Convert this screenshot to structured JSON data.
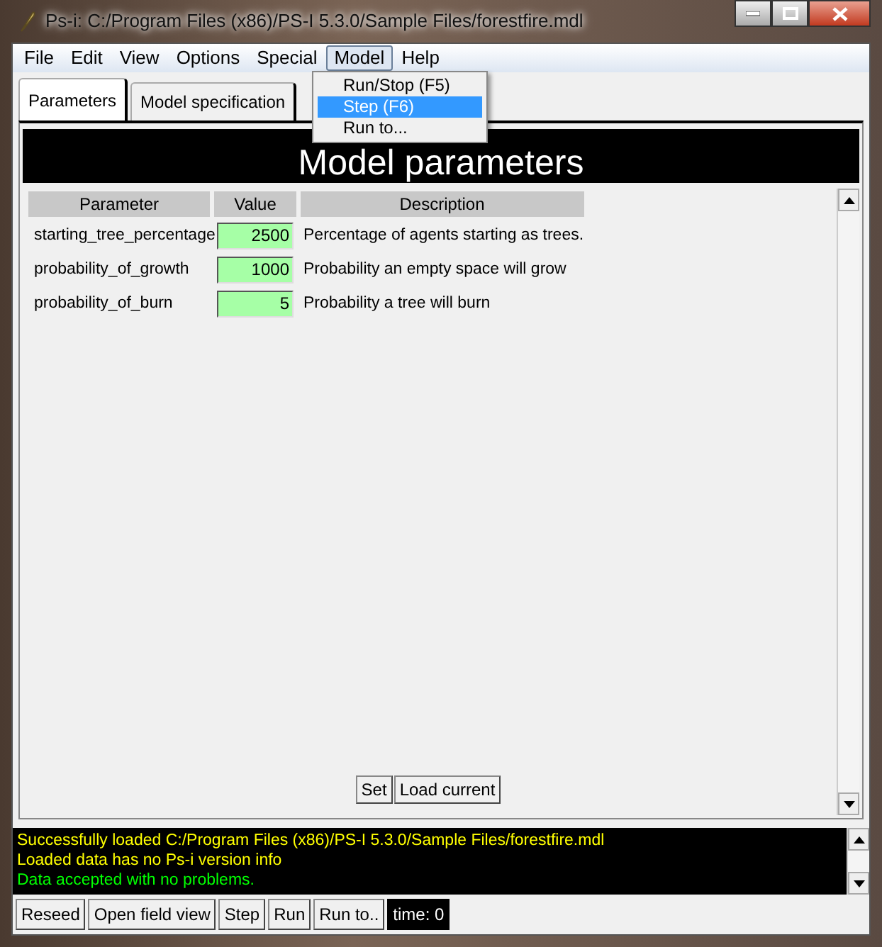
{
  "window": {
    "title": "Ps-i: C:/Program Files (x86)/PS-I 5.3.0/Sample Files/forestfire.mdl"
  },
  "menu": [
    {
      "label": "File",
      "selected": false
    },
    {
      "label": "Edit",
      "selected": false
    },
    {
      "label": "View",
      "selected": false
    },
    {
      "label": "Options",
      "selected": false
    },
    {
      "label": "Special",
      "selected": false
    },
    {
      "label": "Model",
      "selected": true
    },
    {
      "label": "Help",
      "selected": false
    }
  ],
  "dropdown": [
    {
      "label": "Run/Stop (F5)",
      "selected": false
    },
    {
      "label": "Step (F6)",
      "selected": true
    },
    {
      "label": "Run to...",
      "selected": false
    }
  ],
  "tabs": [
    {
      "label": "Parameters",
      "selected": true
    },
    {
      "label": "Model specification",
      "selected": false
    }
  ],
  "panel_title": "Model parameters",
  "table": {
    "columns": [
      "Parameter",
      "Value",
      "Description"
    ],
    "rows": [
      {
        "parameter": "starting_tree_percentage",
        "value": "2500",
        "description": "Percentage of agents starting as trees."
      },
      {
        "parameter": "probability_of_growth",
        "value": "1000",
        "description": "Probability an empty space will grow"
      },
      {
        "parameter": "probability_of_burn",
        "value": "5",
        "description": "Probability a tree will burn"
      }
    ]
  },
  "panel_buttons": [
    "Set",
    "Load current"
  ],
  "log": [
    {
      "text": "Successfully loaded C:/Program Files (x86)/PS-I 5.3.0/Sample Files/forestfire.mdl",
      "color": "#ffff00"
    },
    {
      "text": "Loaded data has no Ps-i version info",
      "color": "#ffff00"
    },
    {
      "text": "Data accepted with no problems.",
      "color": "#00ff00"
    }
  ],
  "bottom_buttons": [
    "Reseed",
    "Open field view",
    "Step",
    "Run",
    "Run to.."
  ],
  "time": "time: 0"
}
